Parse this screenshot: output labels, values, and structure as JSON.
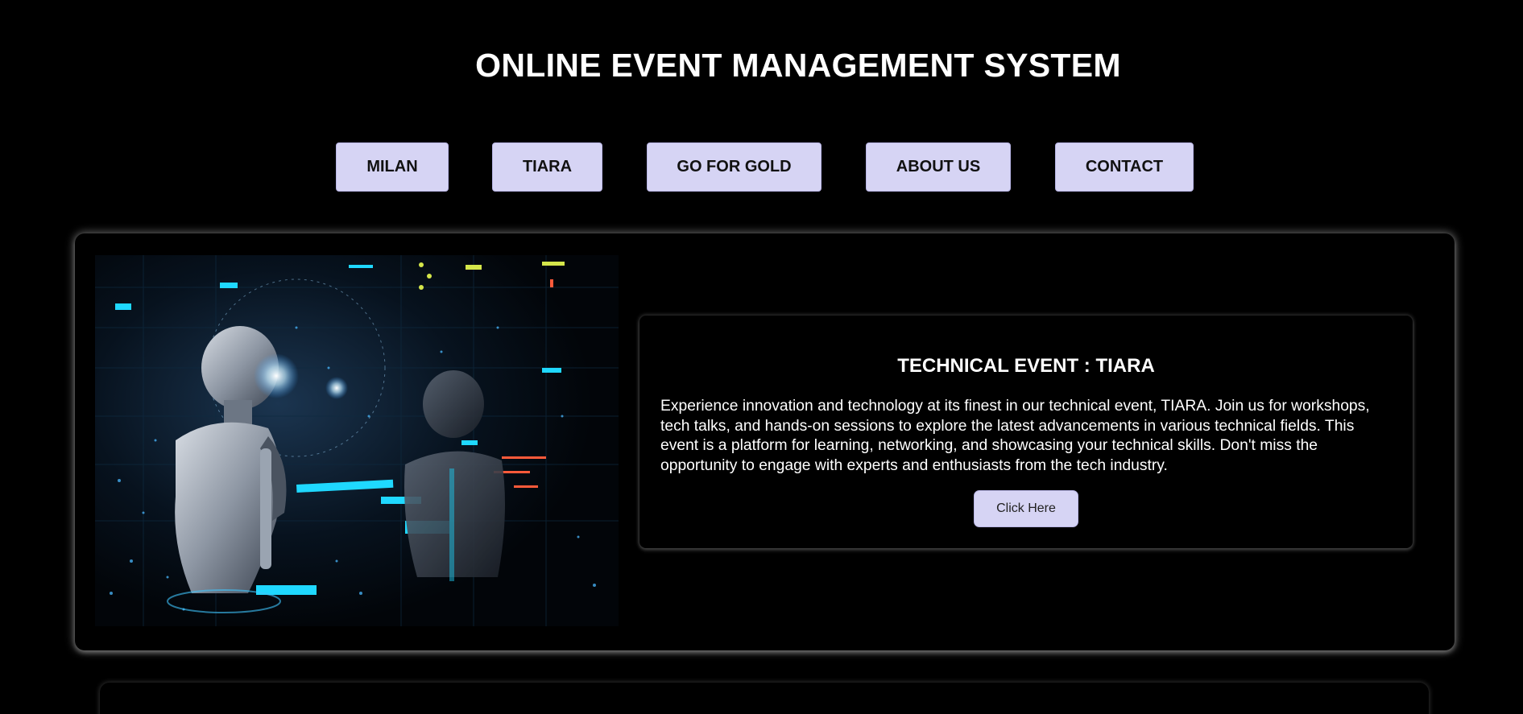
{
  "header": {
    "title": "ONLINE EVENT MANAGEMENT SYSTEM"
  },
  "nav": {
    "items": [
      {
        "label": "MILAN"
      },
      {
        "label": "TIARA"
      },
      {
        "label": "GO FOR GOLD"
      },
      {
        "label": "ABOUT US"
      },
      {
        "label": "CONTACT"
      }
    ]
  },
  "event_card": {
    "image_alt": "robots-tech-image",
    "heading": "TECHNICAL EVENT : TIARA",
    "description": "Experience innovation and technology at its finest in our technical event, TIARA. Join us for workshops, tech talks, and hands-on sessions to explore the latest advancements in various technical fields. This event is a platform for learning, networking, and showcasing your technical skills. Don't miss the opportunity to engage with experts and enthusiasts from the tech industry.",
    "button_label": "Click Here"
  },
  "theme": {
    "background": "#000000",
    "button_bg": "#d6d4f4",
    "text": "#ffffff"
  }
}
